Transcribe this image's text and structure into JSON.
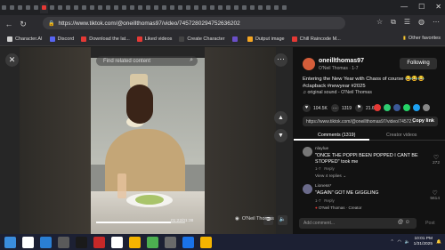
{
  "browser": {
    "tab_count": 36,
    "url": "https://www.tiktok.com/@oneillthomas97/video/7457280294752636202",
    "window_controls": [
      "—",
      "☐",
      "✕"
    ]
  },
  "bookmarks": [
    {
      "label": "Character.AI",
      "color": "#cfcfcf"
    },
    {
      "label": "Discord",
      "color": "#5865F2"
    },
    {
      "label": "Download the lat...",
      "color": "#e53935"
    },
    {
      "label": "Liked videos",
      "color": "#e53935"
    },
    {
      "label": "Create Character",
      "color": "#444444"
    },
    {
      "label": "",
      "color": "#6a4fc7"
    },
    {
      "label": "Output image",
      "color": "#f5a623"
    },
    {
      "label": "Chill Raincode M...",
      "color": "#e53935"
    }
  ],
  "bookmarks_other": "Other favorites",
  "video": {
    "search_placeholder": "Find related content",
    "time": "01:22/01:38",
    "progress": 0.84,
    "report_label": "O'Neil Thomas"
  },
  "panel": {
    "username": "oneillthomas97",
    "display_name": "O'Neil Thomas · 1-7",
    "follow_label": "Following",
    "caption": "Entering the New Year with Chaos of course 😂😂😂 #clapback #newyear #2025",
    "sound": "♫ original sound - O'Neil Thomas",
    "stats": [
      {
        "icon": "♥",
        "count": "104.5K"
      },
      {
        "icon": "…",
        "count": "1319"
      },
      {
        "icon": "⚑",
        "count": "21.6K"
      }
    ],
    "share_colors": [
      "#e53935",
      "#2ecc71",
      "#3b5998",
      "#25d366",
      "#1da1f2",
      "#888888"
    ],
    "link": "https://www.tiktok.com/@oneillthomas97/video/74572...",
    "copy_link": "Copy link",
    "tab_comments": "Comments (1319)",
    "tab_creator": "Creator videos",
    "comments": [
      {
        "user": "nlaylue",
        "text": "\"ONCE THE POPPI BEEN POPPED I CANT BE STOPPED\" took me",
        "date": "1-7",
        "reply": "Reply",
        "likes": "272",
        "avatar_color": "#777777",
        "view_replies": "View 4 replies ⌄"
      },
      {
        "user": "Lioness*",
        "text": "\"AGAIN\" GOT ME GIGGLING",
        "date": "1-7",
        "reply": "Reply",
        "likes": "5614",
        "avatar_color": "#6a6a8a",
        "liked_by": "O'Neil Thomas · Creator"
      }
    ],
    "add_comment": "Add comment...",
    "post_label": "Post"
  },
  "taskbar": {
    "time": "10:01 PM",
    "date": "1/31/2025",
    "icons": [
      "#3a8dde",
      "#ffffff",
      "#2a7fd4",
      "#5a5a5a",
      "#1a1a1a",
      "#c62828",
      "#ffffff",
      "#f4b400",
      "#4caf50",
      "#6a6a6a",
      "#1a73e8",
      "#f4b400"
    ]
  }
}
